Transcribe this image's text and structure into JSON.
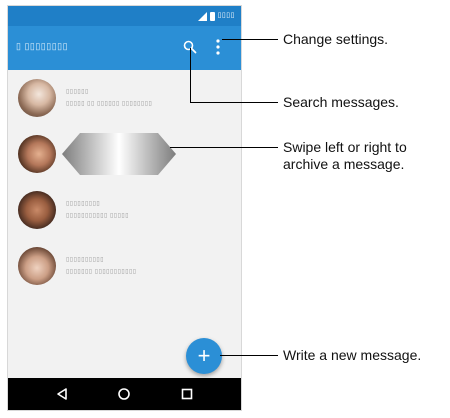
{
  "status_bar": {
    "time": "▯▯▯▯"
  },
  "app_bar": {
    "title": "▯ ▯▯▯▯▯▯▯▯"
  },
  "conversations": [
    {
      "name": "▯▯▯▯▯▯",
      "preview": "▯▯▯▯▯ ▯▯ ▯▯▯▯▯▯ ▯▯▯▯▯▯▯▯"
    },
    {
      "name": "",
      "preview": ""
    },
    {
      "name": "▯▯▯▯▯▯▯▯▯",
      "preview": "▯▯▯▯▯▯▯▯▯▯▯ ▯▯▯▯▯"
    },
    {
      "name": "▯▯▯▯▯▯▯▯▯▯",
      "preview": "▯▯▯▯▯▯▯ ▯▯▯▯▯▯▯▯▯▯▯"
    }
  ],
  "fab": {
    "icon": "+"
  },
  "callouts": {
    "settings": "Change settings.",
    "search": "Search messages.",
    "swipe_line1": "Swipe left or right to",
    "swipe_line2": "archive a message.",
    "compose": "Write a new message."
  },
  "colors": {
    "status_bar": "#1f7fc7",
    "app_bar": "#2b8fd6",
    "accent": "#2b8fd6",
    "nav_bar": "#000000"
  },
  "icons": {
    "search": "search-icon",
    "menu": "more-vert-icon",
    "compose": "plus-icon",
    "back": "back-triangle-icon",
    "home": "home-circle-icon",
    "recent": "recent-square-icon",
    "swipe": "swipe-arrow-icon"
  }
}
